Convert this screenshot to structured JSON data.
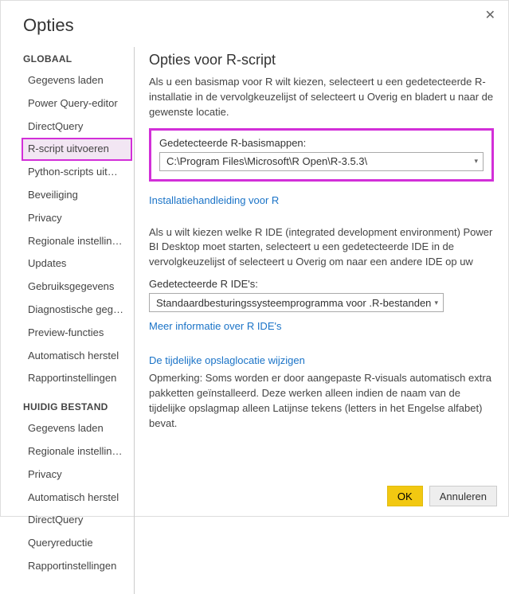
{
  "dialog": {
    "title": "Opties"
  },
  "sidebar": {
    "global_header": "GLOBAAL",
    "global_items": [
      "Gegevens laden",
      "Power Query-editor",
      "DirectQuery",
      "R-script uitvoeren",
      "Python-scripts uit…",
      "Beveiliging",
      "Privacy",
      "Regionale instellin…",
      "Updates",
      "Gebruiksgegevens",
      "Diagnostische geg…",
      "Preview-functies",
      "Automatisch herstel",
      "Rapportinstellingen"
    ],
    "current_header": "HUIDIG BESTAND",
    "current_items": [
      "Gegevens laden",
      "Regionale instellin…",
      "Privacy",
      "Automatisch herstel",
      "DirectQuery",
      "Queryreductie",
      "Rapportinstellingen"
    ],
    "selected_index": 3
  },
  "panel": {
    "title": "Opties voor R-script",
    "intro": "Als u een basismap voor R wilt kiezen, selecteert u een gedetecteerde R-installatie in de vervolgkeuzelijst of selecteert u Overig en bladert u naar de gewenste locatie.",
    "r_home_label": "Gedetecteerde R-basismappen:",
    "r_home_value": "C:\\Program Files\\Microsoft\\R Open\\R-3.5.3\\",
    "r_install_link": "Installatiehandleiding voor R",
    "ide_intro": "Als u wilt kiezen welke R IDE (integrated development environment) Power BI Desktop moet starten, selecteert u een gedetecteerde IDE in de vervolgkeuzelijst of selecteert u Overig om naar een andere IDE op uw",
    "ide_label": "Gedetecteerde R IDE's:",
    "ide_value": "Standaardbesturingssysteemprogramma voor .R-bestanden",
    "ide_link": "Meer informatie over R IDE's",
    "temp_link": "De tijdelijke opslaglocatie wijzigen",
    "temp_note": "Opmerking: Soms worden er door aangepaste R-visuals automatisch extra pakketten geïnstalleerd. Deze werken alleen indien de naam van de tijdelijke opslagmap alleen Latijnse tekens (letters in het Engelse alfabet) bevat."
  },
  "footer": {
    "ok": "OK",
    "cancel": "Annuleren"
  }
}
